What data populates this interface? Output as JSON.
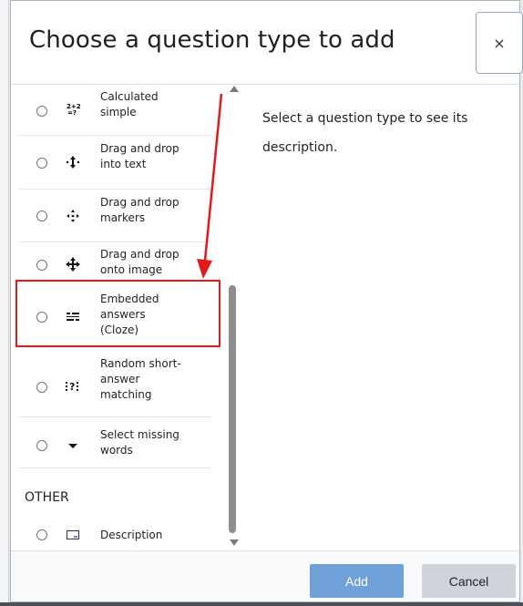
{
  "modal": {
    "title": "Choose a question type to add",
    "close_label": "×"
  },
  "options": [
    {
      "label": "Calculated simple",
      "icon": "calculated-simple-icon",
      "icon_glyph": "2+2\n=?"
    },
    {
      "label": "Drag and drop into text",
      "icon": "drag-drop-text-icon",
      "icon_glyph": "·↕·"
    },
    {
      "label": "Drag and drop markers",
      "icon": "drag-drop-markers-icon",
      "icon_glyph": "✦"
    },
    {
      "label": "Drag and drop onto image",
      "icon": "drag-drop-image-icon",
      "icon_glyph": "✚"
    },
    {
      "label": "Embedded answers (Cloze)",
      "icon": "cloze-icon",
      "icon_glyph": "☷"
    },
    {
      "label": "Random short-answer matching",
      "icon": "random-short-answer-icon",
      "icon_glyph": "⁝?⁝"
    },
    {
      "label": "Select missing words",
      "icon": "select-missing-words-icon",
      "icon_glyph": "▼"
    }
  ],
  "section_other": {
    "heading": "OTHER",
    "items": [
      {
        "label": "Description",
        "icon": "description-icon",
        "icon_glyph": "▤"
      }
    ]
  },
  "description_pane": {
    "text": "Select a question type to see its description."
  },
  "footer": {
    "add_label": "Add",
    "cancel_label": "Cancel"
  },
  "colors": {
    "add_button": "#6fa0d8",
    "cancel_button": "#ced4da",
    "annotation_red": "#e11919"
  }
}
